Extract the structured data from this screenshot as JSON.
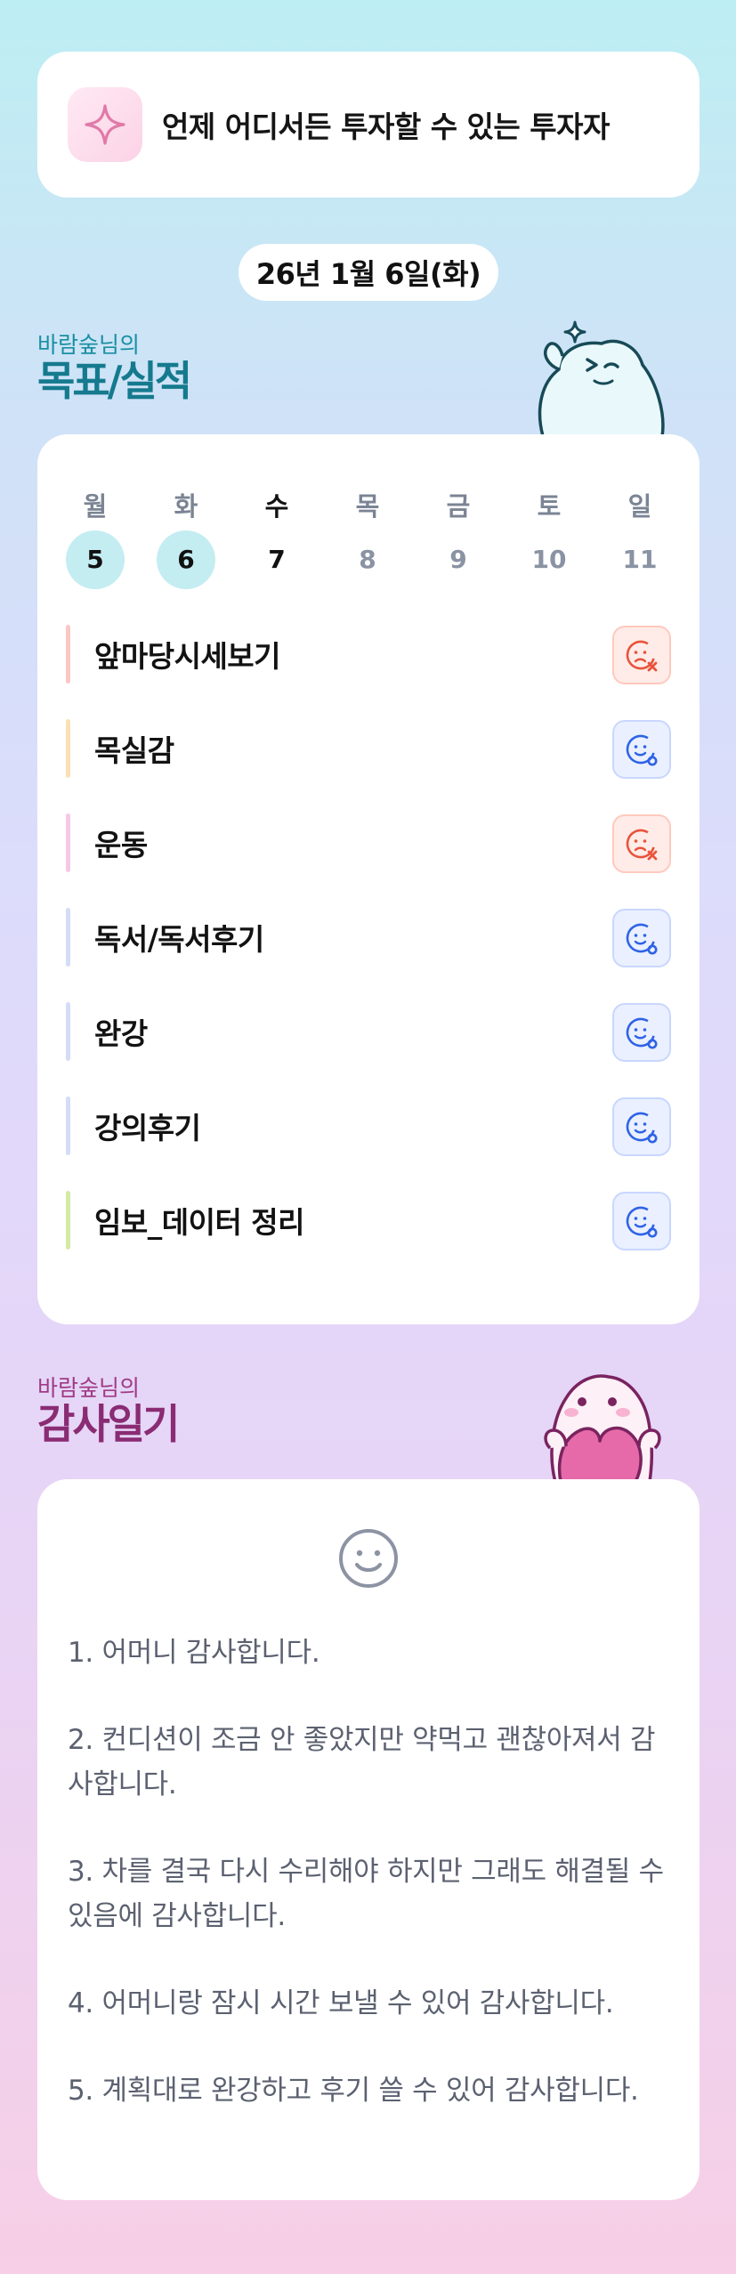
{
  "motto": {
    "text": "언제 어디서든 투자할 수 있는 투자자",
    "icon": "sparkle-icon",
    "accent": "#e07aa8"
  },
  "date": "26년 1월 6일(화)",
  "goals_section": {
    "subtitle": "바람숲님의",
    "title": "목표/실적",
    "week": [
      {
        "day": "월",
        "num": "5",
        "state": "past"
      },
      {
        "day": "화",
        "num": "6",
        "state": "past"
      },
      {
        "day": "수",
        "num": "7",
        "state": "today"
      },
      {
        "day": "목",
        "num": "8",
        "state": "future"
      },
      {
        "day": "금",
        "num": "9",
        "state": "future"
      },
      {
        "day": "토",
        "num": "10",
        "state": "future"
      },
      {
        "day": "일",
        "num": "11",
        "state": "future"
      }
    ],
    "goals": [
      {
        "label": "앞마당시세보기",
        "color": "#fbc7c4",
        "status": "fail"
      },
      {
        "label": "목실감",
        "color": "#fbe0b5",
        "status": "done"
      },
      {
        "label": "운동",
        "color": "#f6c8e6",
        "status": "fail"
      },
      {
        "label": "독서/독서후기",
        "color": "#d5dcf7",
        "status": "done"
      },
      {
        "label": "완강",
        "color": "#d5dcf7",
        "status": "done"
      },
      {
        "label": "강의후기",
        "color": "#d5dcf7",
        "status": "done"
      },
      {
        "label": "임보_데이터 정리",
        "color": "#d5eba4",
        "status": "done"
      }
    ]
  },
  "thanks_section": {
    "subtitle": "바람숲님의",
    "title": "감사일기",
    "icon": "smile-face-icon",
    "items": [
      "1. 어머니 감사합니다.",
      "2. 컨디션이 조금 안 좋았지만 약먹고 괜찮아져서 감사합니다.",
      "3. 차를 결국 다시 수리해야 하지만 그래도 해결될 수 있음에 감사합니다.",
      "4. 어머니랑 잠시 시간 보낼 수 있어 감사합니다.",
      "5. 계획대로 완강하고 후기 쓸 수 있어 감사합니다."
    ]
  },
  "colors": {
    "fail": "#e8533b",
    "done": "#2f63e6",
    "teal": "#157a8e",
    "plum": "#8a2c73"
  }
}
